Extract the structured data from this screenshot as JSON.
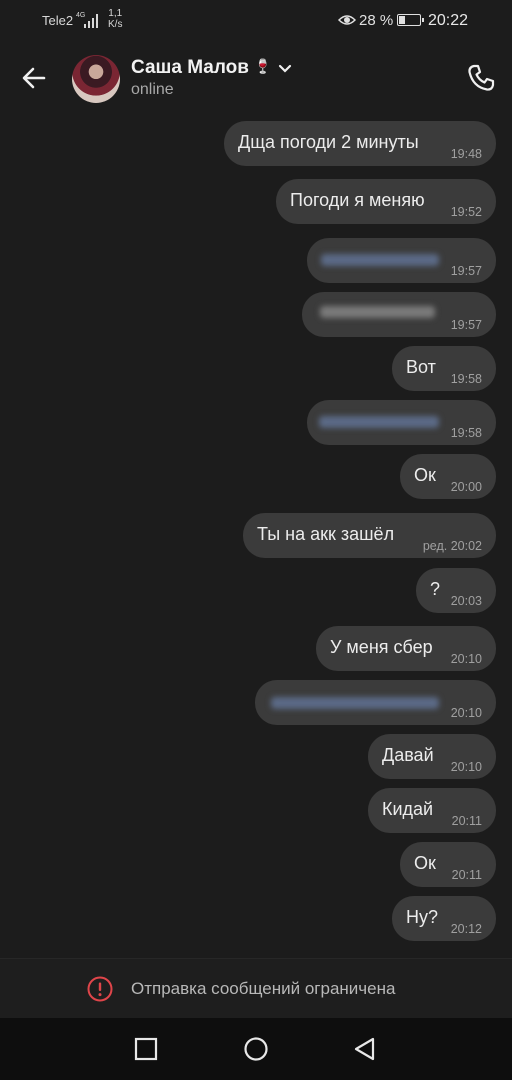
{
  "status_bar": {
    "carrier": "Tele2",
    "network": "4G",
    "speed_value": "1,1",
    "speed_unit": "K/s",
    "battery_percent": "28 %",
    "battery_level": 0.28,
    "time": "20:22"
  },
  "header": {
    "contact_name": "Саша Малов",
    "contact_emoji": "🍷",
    "contact_status": "online"
  },
  "messages": [
    {
      "text": "Дща погоди 2 минуты",
      "time": "19:48"
    },
    {
      "text": "Погоди я меняю",
      "time": "19:52"
    },
    {
      "text": "",
      "time": "19:57",
      "blurred": true
    },
    {
      "text": "",
      "time": "19:57",
      "blurred": true
    },
    {
      "text": "Вот",
      "time": "19:58"
    },
    {
      "text": "",
      "time": "19:58",
      "blurred": true
    },
    {
      "text": "Ок",
      "time": "20:00"
    },
    {
      "text": "Ты на акк зашёл",
      "time": "ред. 20:02"
    },
    {
      "text": "?",
      "time": "20:03"
    },
    {
      "text": "У меня сбер",
      "time": "20:10"
    },
    {
      "text": "",
      "time": "20:10",
      "blurred": true
    },
    {
      "text": "Давай",
      "time": "20:10"
    },
    {
      "text": "Кидай",
      "time": "20:11"
    },
    {
      "text": "Ок",
      "time": "20:11"
    },
    {
      "text": "Ну?",
      "time": "20:12"
    }
  ],
  "footer": {
    "restriction_text": "Отправка сообщений ограничена"
  },
  "icons": {
    "back": "arrow-left-icon",
    "call": "phone-icon",
    "restriction": "alert-circle-icon",
    "nav_recent": "square-icon",
    "nav_home": "circle-icon",
    "nav_back": "triangle-back-icon"
  },
  "colors": {
    "background": "#1c1c1c",
    "bubble": "#3b3b3b",
    "alert": "#e0454a"
  }
}
